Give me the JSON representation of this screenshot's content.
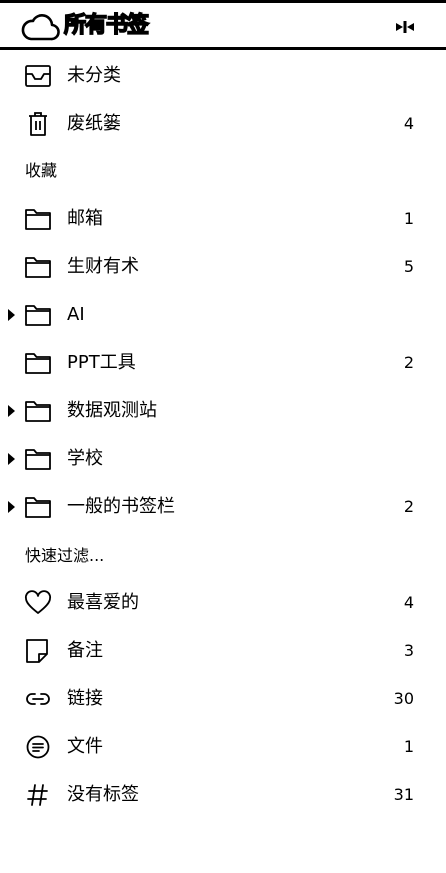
{
  "header": {
    "title": "所有书签"
  },
  "top_items": [
    {
      "label": "未分类",
      "count": ""
    },
    {
      "label": "废纸篓",
      "count": "4"
    }
  ],
  "collections": {
    "heading": "收藏",
    "items": [
      {
        "label": "邮箱",
        "count": "1",
        "expandable": false
      },
      {
        "label": "生财有术",
        "count": "5",
        "expandable": false
      },
      {
        "label": "AI",
        "count": "",
        "expandable": true
      },
      {
        "label": "PPT工具",
        "count": "2",
        "expandable": false
      },
      {
        "label": "数据观测站",
        "count": "",
        "expandable": true
      },
      {
        "label": "学校",
        "count": "",
        "expandable": true
      },
      {
        "label": "一般的书签栏",
        "count": "2",
        "expandable": true
      }
    ]
  },
  "filters": {
    "heading": "快速过滤...",
    "items": [
      {
        "label": "最喜爱的",
        "count": "4",
        "icon": "heart-icon"
      },
      {
        "label": "备注",
        "count": "3",
        "icon": "note-icon"
      },
      {
        "label": "链接",
        "count": "30",
        "icon": "link-icon"
      },
      {
        "label": "文件",
        "count": "1",
        "icon": "file-icon"
      },
      {
        "label": "没有标签",
        "count": "31",
        "icon": "hash-icon"
      }
    ]
  }
}
